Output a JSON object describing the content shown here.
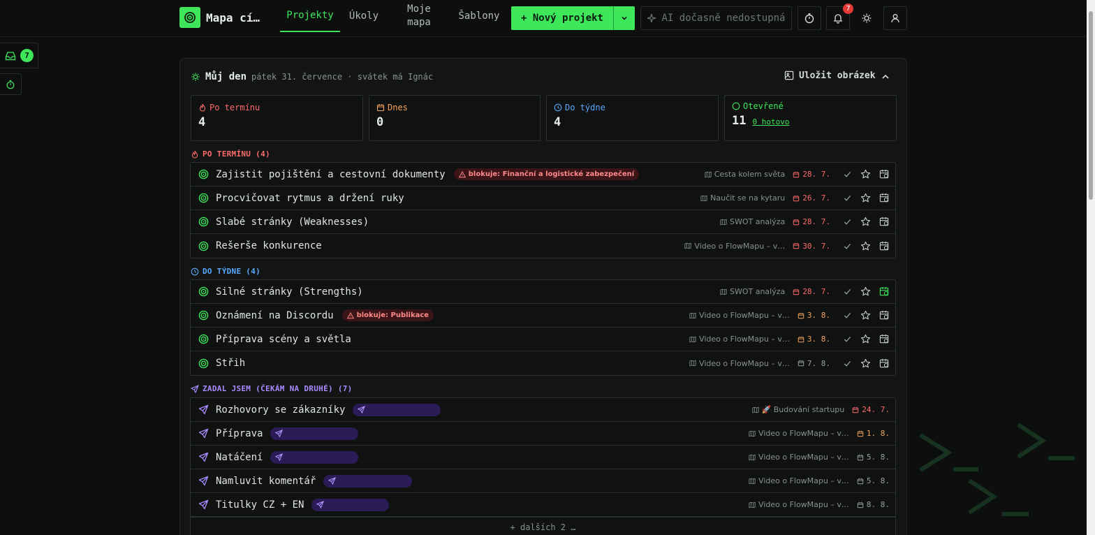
{
  "header": {
    "brand": "Mapa cí…",
    "tabs": [
      {
        "label": "Projekty",
        "active": true
      },
      {
        "label": "Úkoly",
        "active": false
      },
      {
        "label": "Moje mapa",
        "active": false
      },
      {
        "label": "Šablony",
        "active": false
      }
    ],
    "new_project": "+ Nový projekt",
    "ai_label": "AI dočasně nedostupná",
    "notification_count": "7",
    "accent": "#3ee65a"
  },
  "sidebar": {
    "inbox_count": "7"
  },
  "day": {
    "title": "Můj den",
    "subtitle": "pátek 31. července · svátek má Ignác",
    "save_image": "Uložit obrázek",
    "stats": [
      {
        "label": "Po termínu",
        "value": "4",
        "color": "#ff6b6b",
        "icon": "flame-icon"
      },
      {
        "label": "Dnes",
        "value": "0",
        "color": "#f5a35c",
        "icon": "calendar-icon"
      },
      {
        "label": "Do týdne",
        "value": "4",
        "color": "#5aa9ff",
        "icon": "clock-icon"
      },
      {
        "label": "Otevřené",
        "value": "11",
        "link": "0 hotovo",
        "color": "#3ee65a",
        "icon": "circle-icon"
      }
    ]
  },
  "sections": {
    "overdue": {
      "title": "PO TERMÍNU (4)",
      "color": "#ff6b6b",
      "items": [
        {
          "title": "Zajistit pojištění a cestovní dokumenty",
          "block": "blokuje: Finanční a logistické zabezpečení",
          "project": "Cesta kolem světa",
          "due": "28. 7."
        },
        {
          "title": "Procvičovat rytmus a držení ruky",
          "project": "Naučit se na kytaru",
          "due": "26. 7."
        },
        {
          "title": "Slabé stránky (Weaknesses)",
          "project": "SWOT analýza",
          "due": "28. 7."
        },
        {
          "title": "Rešerše konkurence",
          "project": "Video o FlowMapu – v…",
          "due": "30. 7."
        }
      ]
    },
    "week": {
      "title": "DO TÝDNE (4)",
      "color": "#5aa9ff",
      "items": [
        {
          "title": "Silné stránky (Strengths)",
          "project": "SWOT analýza",
          "due": "28. 7.",
          "due_color": "#ff6b6b"
        },
        {
          "title": "Oznámení na Discordu",
          "block": "blokuje: Publikace",
          "project": "Video o FlowMapu – v…",
          "due": "3. 8.",
          "due_color": "#f5a35c"
        },
        {
          "title": "Příprava scény a světla",
          "project": "Video o FlowMapu – v…",
          "due": "3. 8.",
          "due_color": "#f5a35c"
        },
        {
          "title": "Střih",
          "project": "Video o FlowMapu – v…",
          "due": "7. 8.",
          "due_color": "#9aa19d"
        }
      ]
    },
    "delegated": {
      "title": "ZADAL JSEM (ČEKÁM NA DRUHÉ) (7)",
      "color": "#a88bff",
      "items": [
        {
          "title": "Rozhovory se zákazníky",
          "project": "🚀 Budování startupu",
          "due": "24. 7.",
          "due_color": "#ff6b6b"
        },
        {
          "title": "Příprava",
          "project": "Video o FlowMapu – v…",
          "due": "1. 8.",
          "due_color": "#f5a35c"
        },
        {
          "title": "Natáčení",
          "project": "Video o FlowMapu – v…",
          "due": "5. 8.",
          "due_color": "#9aa19d"
        },
        {
          "title": "Namluvit komentář",
          "project": "Video o FlowMapu – v…",
          "due": "5. 8.",
          "due_color": "#9aa19d"
        },
        {
          "title": "Titulky CZ + EN",
          "project": "Video o FlowMapu – v…",
          "due": "8. 8.",
          "due_color": "#9aa19d"
        }
      ],
      "more": "+ dalších 2 …"
    }
  }
}
